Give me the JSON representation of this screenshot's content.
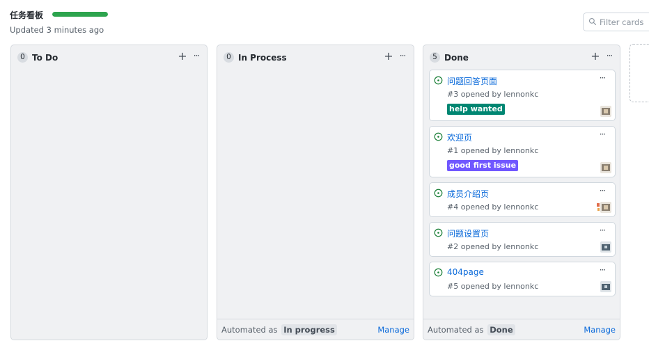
{
  "board": {
    "title": "任务看板",
    "progress_fraction": 1.0,
    "progress_color": "#2da44e",
    "updated": "Updated 3 minutes ago"
  },
  "filter": {
    "placeholder": "Filter cards",
    "icon": "search-icon"
  },
  "columns": [
    {
      "name": "To Do",
      "count": "0",
      "footer": null
    },
    {
      "name": "In Process",
      "count": "0",
      "footer": {
        "automated_label": "Automated as",
        "state": "In progress",
        "manage": "Manage"
      }
    },
    {
      "name": "Done",
      "count": "5",
      "footer": {
        "automated_label": "Automated as",
        "state": "Done",
        "manage": "Manage"
      }
    }
  ],
  "cards": [
    {
      "title": "问题回答页面",
      "meta": "#3 opened by lennonkc",
      "label": "help wanted",
      "label_color": "#008672"
    },
    {
      "title": "欢迎页",
      "meta": "#1 opened by lennonkc",
      "label": "good first issue",
      "label_color": "#7057ff"
    },
    {
      "title": "成员介绍页",
      "meta": "#4 opened by lennonkc",
      "label": null
    },
    {
      "title": "问题设置页",
      "meta": "#2 opened by lennonkc",
      "label": null
    },
    {
      "title": "404page",
      "meta": "#5 opened by lennonkc",
      "label": null
    }
  ],
  "icons": {
    "open_issue": "issue-opened-icon",
    "add": "plus-icon",
    "more": "kebab-horizontal-icon"
  }
}
